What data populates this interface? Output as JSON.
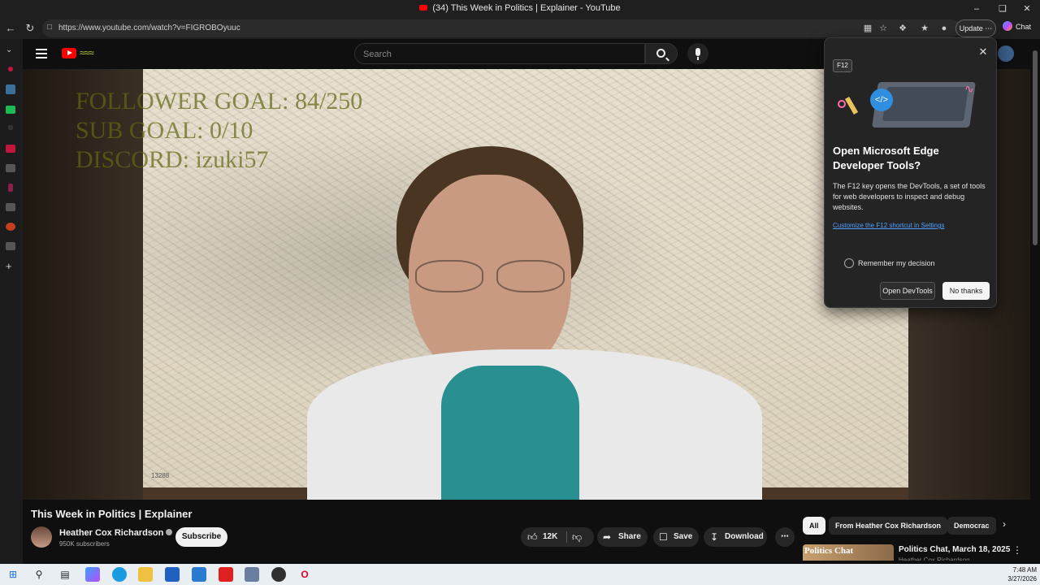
{
  "browser": {
    "tab_title": "(34) This Week in Politics | Explainer - YouTube",
    "url": "https://www.youtube.com/watch?v=FIGROBOyuuc",
    "update_label": "Update",
    "chat_label": "Chat"
  },
  "youtube": {
    "search_placeholder": "Search",
    "video_overlay": {
      "line1": "FOLLOWER GOAL:  84/250",
      "line2": "SUB GOAL: 0/10",
      "line3": "DISCORD: izuki57"
    },
    "map_label": "13288",
    "video_title": "This Week in Politics | Explainer",
    "channel_name": "Heather Cox Richardson",
    "subscribers": "950K subscribers",
    "subscribe_label": "Subscribe",
    "likes": "12K",
    "share_label": "Share",
    "save_label": "Save",
    "download_label": "Download",
    "more_label": "⋯",
    "chips": [
      "All",
      "From Heather Cox Richardson",
      "Democrac"
    ],
    "recommended": {
      "thumb_text": "Politics Chat",
      "title": "Politics Chat, March 18, 2025",
      "channel": "Heather Cox Richardson"
    }
  },
  "devtools_popup": {
    "badge": "F12",
    "heading": "Open Microsoft Edge Developer Tools?",
    "description": "The F12 key opens the DevTools, a set of tools for web developers to inspect and debug websites.",
    "link": "Customize the F12 shortcut in Settings",
    "remember": "Remember my decision",
    "open_button": "Open DevTools",
    "no_button": "No thanks"
  },
  "taskbar": {
    "time": "7:48 AM",
    "date": "3/27/2026"
  },
  "colors": {
    "youtube_red": "#ff0000",
    "link_blue": "#4ea1ff",
    "overlay_olive": "#606814"
  }
}
